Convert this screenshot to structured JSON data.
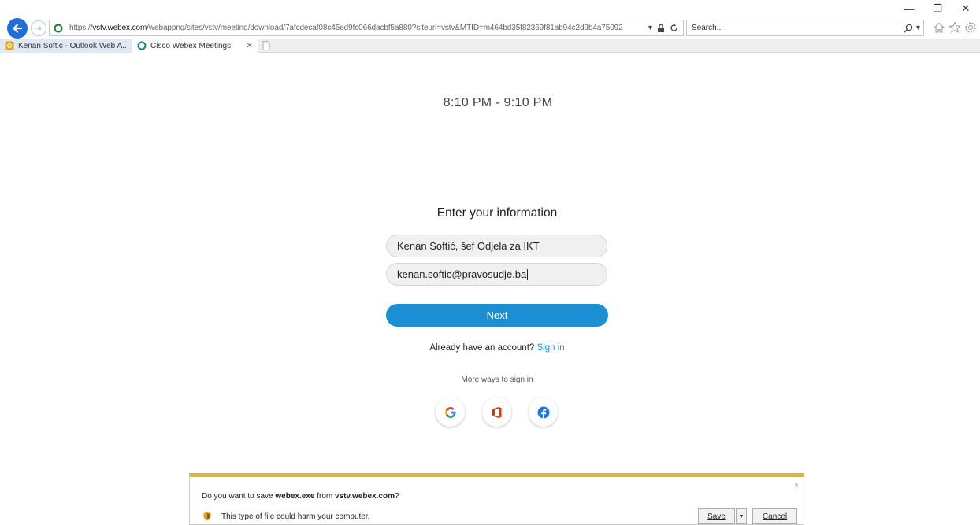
{
  "browser": {
    "window_controls": {
      "minimize": "—",
      "restore": "❐",
      "close": "✕"
    },
    "address": {
      "url_prefix": "https://",
      "url_domain": "vstv.webex.com",
      "url_rest": "/webappng/sites/vstv/meeting/download/7afcdecaf08c45ed9fc066dacbf5a880?siteurl=vstv&MTID=m464bd35f82369f81ab94c2d9b4a75092"
    },
    "search": {
      "placeholder": "Search..."
    },
    "tabs": [
      {
        "label": "Kenan Softic - Outlook Web A...",
        "icon": "outlook-icon"
      },
      {
        "label": "Cisco Webex Meetings",
        "icon": "webex-icon",
        "close": "✕"
      }
    ]
  },
  "meeting": {
    "time": "8:10 PM - 9:10 PM"
  },
  "form": {
    "title": "Enter your information",
    "name_value": "Kenan Softić, šef Odjela za IKT",
    "email_value": "kenan.softic@pravosudje.ba",
    "next_label": "Next",
    "account_question": "Already have an account?",
    "sign_in_label": "Sign in",
    "more_ways": "More ways to sign in",
    "social": [
      "google-icon",
      "office-icon",
      "facebook-icon"
    ]
  },
  "download": {
    "question_prefix": "Do you want to save ",
    "file_name": "webex.exe",
    "question_middle": " from ",
    "source": "vstv.webex.com",
    "question_suffix": "?",
    "warning": "This type of file could harm your computer.",
    "save_label": "Save",
    "cancel_label": "Cancel",
    "close": "×"
  },
  "colors": {
    "accent": "#1a8fd4",
    "warning_bar": "#e2b52b",
    "back_button": "#1e6fd9"
  }
}
